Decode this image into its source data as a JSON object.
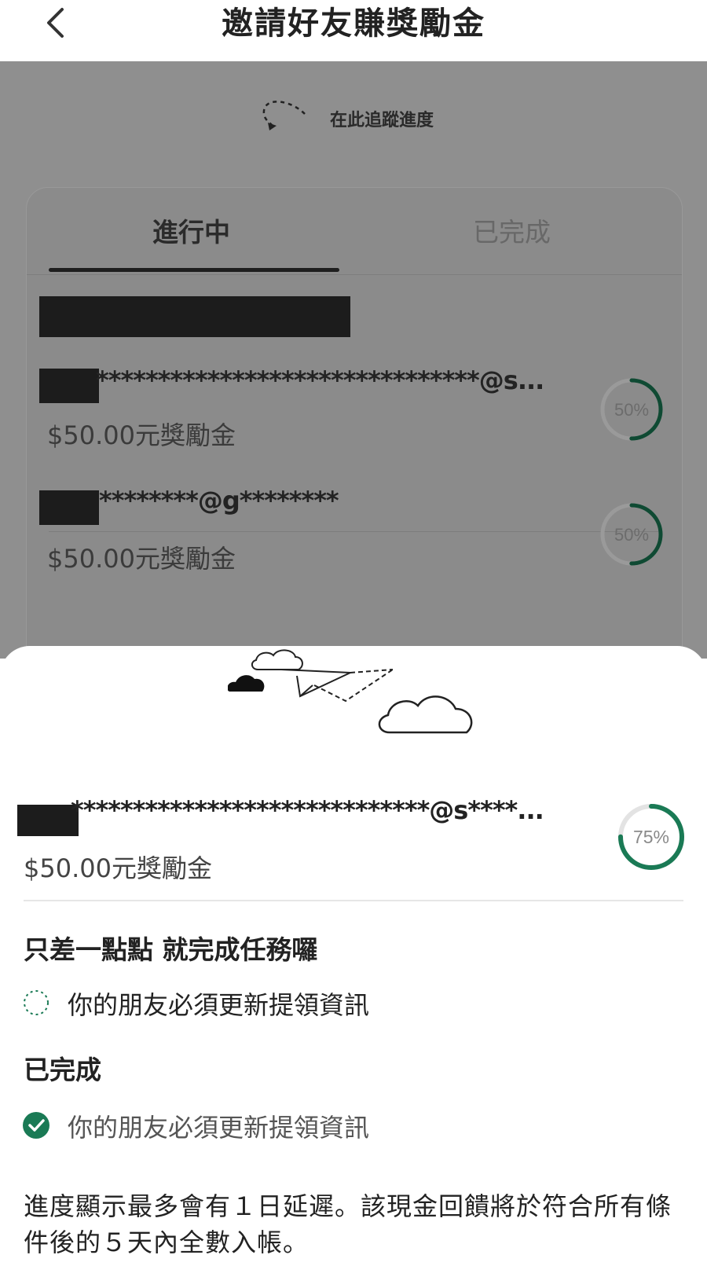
{
  "header": {
    "title": "邀請好友賺獎勵金",
    "back_icon": "chevron-left-icon"
  },
  "tracker_hint": {
    "text": "在此追蹤進度",
    "icon": "dashed-curved-arrow-icon"
  },
  "tabs": [
    {
      "label": "進行中",
      "active": true
    },
    {
      "label": "已完成",
      "active": false
    }
  ],
  "referrals": [
    {
      "email": "*******************************@s...",
      "reward": "$50.00元獎勵金",
      "progress_label": "50%",
      "progress": 0.5
    },
    {
      "email": "********@g********",
      "reward": "$50.00元獎勵金",
      "progress_label": "50%",
      "progress": 0.5
    }
  ],
  "detail": {
    "illustration": "paper-plane-clouds-illustration",
    "email": "*****************************@s****...",
    "reward": "$50.00元獎勵金",
    "progress_label": "75%",
    "progress": 0.75,
    "pending_heading": "只差一點點 就完成任務囉",
    "pending_tasks": [
      {
        "label": "你的朋友必須更新提領資訊",
        "icon": "dashed-circle-icon"
      }
    ],
    "completed_heading": "已完成",
    "completed_tasks": [
      {
        "label": "你的朋友必須更新提領資訊",
        "icon": "check-circle-icon"
      }
    ],
    "note": "進度顯示最多會有１日延遲。該現金回饋將於符合所有條件後的５天內全數入帳。"
  },
  "colors": {
    "accent_green": "#1a7a55",
    "ring_track": "#e3e3e3",
    "overlay": "#8f8f8f"
  }
}
